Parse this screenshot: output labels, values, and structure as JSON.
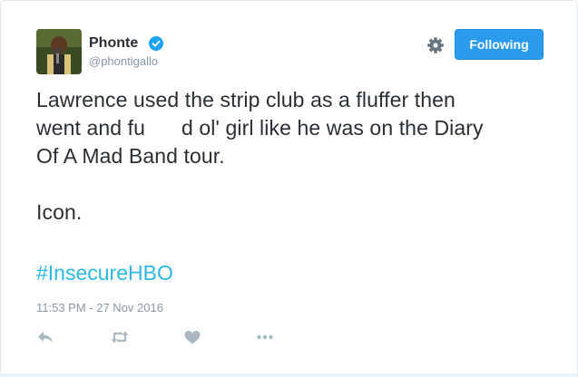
{
  "user": {
    "display_name": "Phonte",
    "screen_name": "@phontigallo",
    "verified": true
  },
  "follow_button": {
    "label": "Following"
  },
  "tweet": {
    "line1": "Lawrence used the strip club as a fluffer then",
    "line2a": "went and fu",
    "line2b": "d ol' girl like he was on the Diary",
    "line3": "Of A Mad Band tour.",
    "line4": "Icon.",
    "hashtag": "#InsecureHBO",
    "timestamp": "11:53 PM - 27 Nov 2016"
  },
  "actions": [
    "reply-icon",
    "retweet-icon",
    "like-icon",
    "more-icon"
  ],
  "colors": {
    "accent": "#2b9bed",
    "hashtag": "#2cb8e0",
    "muted": "#8899a6",
    "text": "#292f33"
  }
}
